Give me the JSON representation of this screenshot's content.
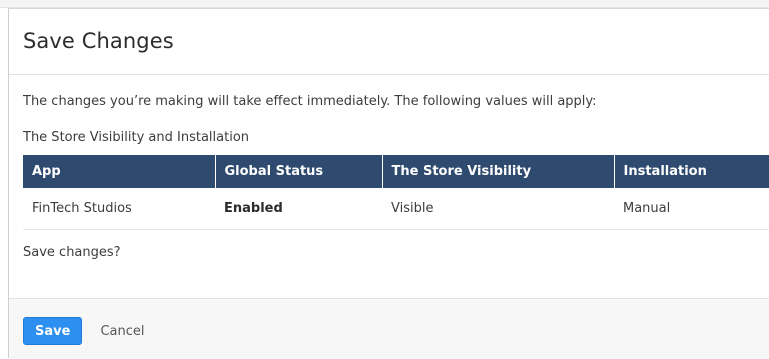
{
  "dialog": {
    "title": "Save Changes",
    "intro": "The changes you’re making will take effect immediately. The following values will apply:",
    "section_label": "The Store Visibility and Installation",
    "table": {
      "headers": [
        "App",
        "Global Status",
        "The Store Visibility",
        "Installation"
      ],
      "rows": [
        [
          "FinTech Studios",
          "Enabled",
          "Visible",
          "Manual"
        ]
      ]
    },
    "confirm": "Save changes?",
    "save_label": "Save",
    "cancel_label": "Cancel"
  },
  "colors": {
    "header_bg": "#2e4a6e",
    "primary_button": "#2d8ff0",
    "footer_bg": "#f7f7f7"
  }
}
